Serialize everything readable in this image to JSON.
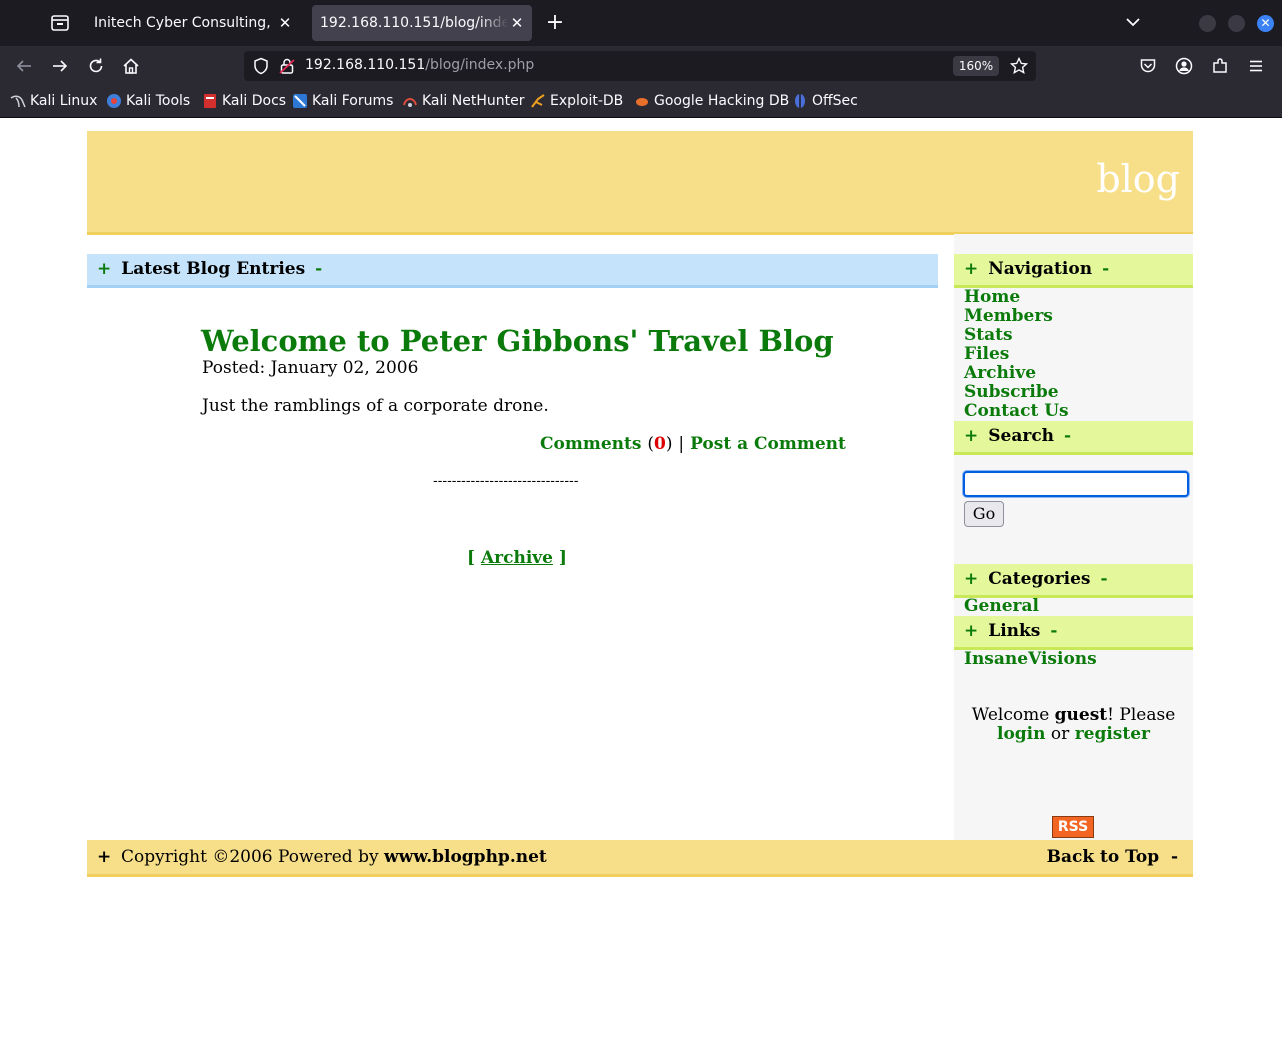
{
  "browser": {
    "tabs": [
      {
        "title": "Initech Cyber Consulting, LLC",
        "active": false
      },
      {
        "title": "192.168.110.151/blog/index.php",
        "active": true
      }
    ],
    "url_host": "192.168.110.151",
    "url_path": "/blog/index.php",
    "zoom": "160%",
    "bookmarks": [
      "Kali Linux",
      "Kali Tools",
      "Kali Docs",
      "Kali Forums",
      "Kali NetHunter",
      "Exploit-DB",
      "Google Hacking DB",
      "OffSec"
    ]
  },
  "site": {
    "title": "blog"
  },
  "main": {
    "section_title": "Latest Blog Entries",
    "plus": "+",
    "minus": "-",
    "post": {
      "title": "Welcome to Peter Gibbons' Travel Blog",
      "date": "Posted: January 02, 2006",
      "body": "Just the ramblings of a corporate drone.",
      "comments_label": "Comments",
      "comments_count": "0",
      "separator": "|",
      "post_comment_label": "Post a Comment"
    },
    "divider": "-------------------------------",
    "archive_label": "Archive"
  },
  "sidebar": {
    "navigation_title": "Navigation",
    "nav_items": [
      "Home",
      "Members",
      "Stats",
      "Files",
      "Archive",
      "Subscribe",
      "Contact Us"
    ],
    "search_title": "Search",
    "search_value": "",
    "go_label": "Go",
    "categories_title": "Categories",
    "categories": [
      "General"
    ],
    "links_title": "Links",
    "links": [
      "InsaneVisions"
    ],
    "welcome_prefix": "Welcome",
    "welcome_user": "guest",
    "welcome_suffix": "! Please",
    "login_label": "login",
    "or_text": "or",
    "register_label": "register",
    "rss_label": "RSS"
  },
  "footer": {
    "plus": "+",
    "copyright_prefix": "Copyright ©2006 Powered by",
    "powered_link": "www.blogphp.net",
    "back_to_top": "Back to Top",
    "minus": "-"
  }
}
